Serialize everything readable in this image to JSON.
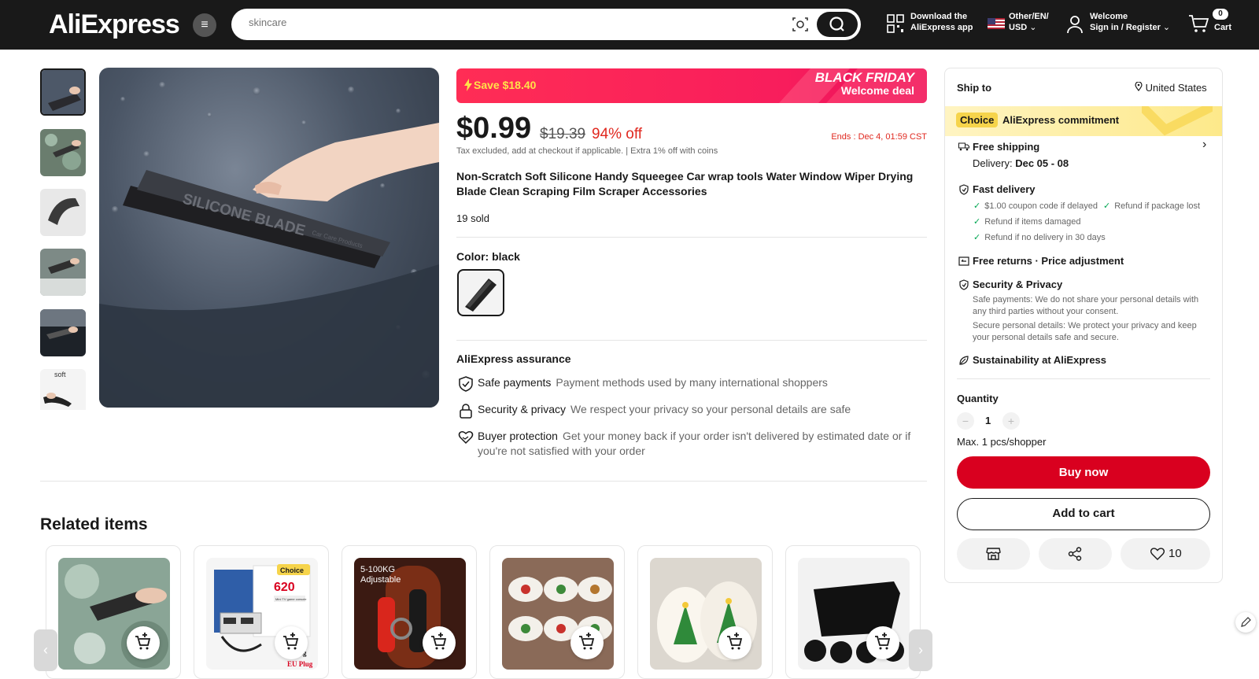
{
  "header": {
    "logo": "AliExpress",
    "search_placeholder": "skincare",
    "download_line1": "Download the",
    "download_line2": "AliExpress app",
    "locale_line1": "Other/EN/",
    "locale_line2": "USD",
    "welcome_line1": "Welcome",
    "welcome_line2": "Sign in / Register",
    "cart_count": "0",
    "cart_label": "Cart"
  },
  "promo": {
    "save": "Save $18.40",
    "event_line1": "BLACK FRIDAY",
    "event_line2": "Welcome deal"
  },
  "product": {
    "price": "$0.99",
    "original_price": "$19.39",
    "discount": "94% off",
    "ends": "Ends :  Dec 4, 01:59 CST",
    "tax_note": "Tax excluded, add at checkout if applicable.  |  Extra 1% off with coins",
    "title": "Non-Scratch Soft Silicone Handy Squeegee Car wrap tools Water Window Wiper Drying Blade Clean Scraping Film Scraper Accessories",
    "sold": "19 sold",
    "color_label": "Color: black",
    "image_text": "SILICONE BLADE",
    "image_subtext": "Car Care Products",
    "thumb_last_text": "soft"
  },
  "assurance": {
    "title": "AliExpress assurance",
    "items": [
      {
        "key": "Safe payments",
        "value": "Payment methods used by many international shoppers"
      },
      {
        "key": "Security & privacy",
        "value": "We respect your privacy so your personal details are safe"
      },
      {
        "key": "Buyer protection",
        "value": "Get your money back if your order isn't delivered by estimated date or if you're not satisfied with your order"
      }
    ]
  },
  "related": {
    "title": "Related items",
    "card2_badge": "Choice",
    "card2_number": "620",
    "card2_sub": "Mini TV game console",
    "card2_tail": "ug",
    "card2_plug": "EU Plug",
    "card3_text": "5-100KG",
    "card3_sub": "Adjustable"
  },
  "panel": {
    "ship_to": "Ship to",
    "country": "United States",
    "choice_badge": "Choice",
    "choice_text": "AliExpress commitment",
    "free_shipping": "Free shipping",
    "delivery_label": "Delivery:",
    "delivery_dates": "Dec 05 - 08",
    "fast_delivery": "Fast delivery",
    "fast_items": [
      "$1.00 coupon code if delayed",
      "Refund if package lost",
      "Refund if items damaged",
      "Refund if no delivery in 30 days"
    ],
    "free_returns": "Free returns · Price adjustment",
    "security": "Security & Privacy",
    "security_text1": "Safe payments: We do not share your personal details with any third parties without your consent.",
    "security_text2": "Secure personal details: We protect your privacy and keep your personal details safe and secure.",
    "sustainability": "Sustainability at AliExpress",
    "quantity_label": "Quantity",
    "quantity_value": "1",
    "max_note": "Max. 1 pcs/shopper",
    "buy_now": "Buy now",
    "add_to_cart": "Add to cart",
    "wishlist_count": "10"
  },
  "colors": {
    "brand_red": "#d9001f",
    "header_bg": "#191919",
    "promo_pink": "#ff2d55",
    "choice_yellow": "#f6d44b",
    "check_green": "#00a651"
  }
}
